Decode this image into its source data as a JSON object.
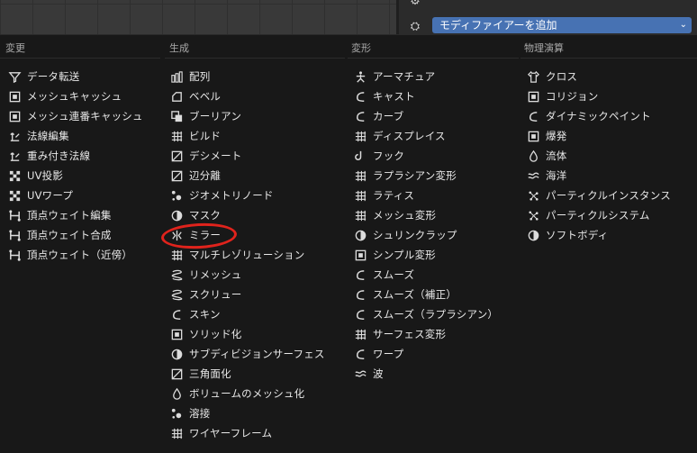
{
  "header": {
    "add_modifier_label": "モディファイアーを追加"
  },
  "columns": [
    {
      "title": "変更",
      "items": [
        "データ転送",
        "メッシュキャッシュ",
        "メッシュ連番キャッシュ",
        "法線編集",
        "重み付き法線",
        "UV投影",
        "UVワープ",
        "頂点ウェイト編集",
        "頂点ウェイト合成",
        "頂点ウェイト（近傍）"
      ]
    },
    {
      "title": "生成",
      "items": [
        "配列",
        "ベベル",
        "ブーリアン",
        "ビルド",
        "デシメート",
        "辺分離",
        "ジオメトリノード",
        "マスク",
        "ミラー",
        "マルチレゾリューション",
        "リメッシュ",
        "スクリュー",
        "スキン",
        "ソリッド化",
        "サブディビジョンサーフェス",
        "三角面化",
        "ボリュームのメッシュ化",
        "溶接",
        "ワイヤーフレーム"
      ]
    },
    {
      "title": "変形",
      "items": [
        "アーマチュア",
        "キャスト",
        "カーブ",
        "ディスプレイス",
        "フック",
        "ラプラシアン変形",
        "ラティス",
        "メッシュ変形",
        "シュリンクラップ",
        "シンプル変形",
        "スムーズ",
        "スムーズ（補正）",
        "スムーズ（ラプラシアン）",
        "サーフェス変形",
        "ワープ",
        "波"
      ]
    },
    {
      "title": "物理演算",
      "items": [
        "クロス",
        "コリジョン",
        "ダイナミックペイント",
        "爆発",
        "流体",
        "海洋",
        "パーティクルインスタンス",
        "パーティクルシステム",
        "ソフトボディ"
      ]
    }
  ],
  "highlighted_item": "ミラー",
  "colors": {
    "accent": "#4772b3",
    "highlight_circle": "#e0231c",
    "menu_bg": "#181818"
  }
}
